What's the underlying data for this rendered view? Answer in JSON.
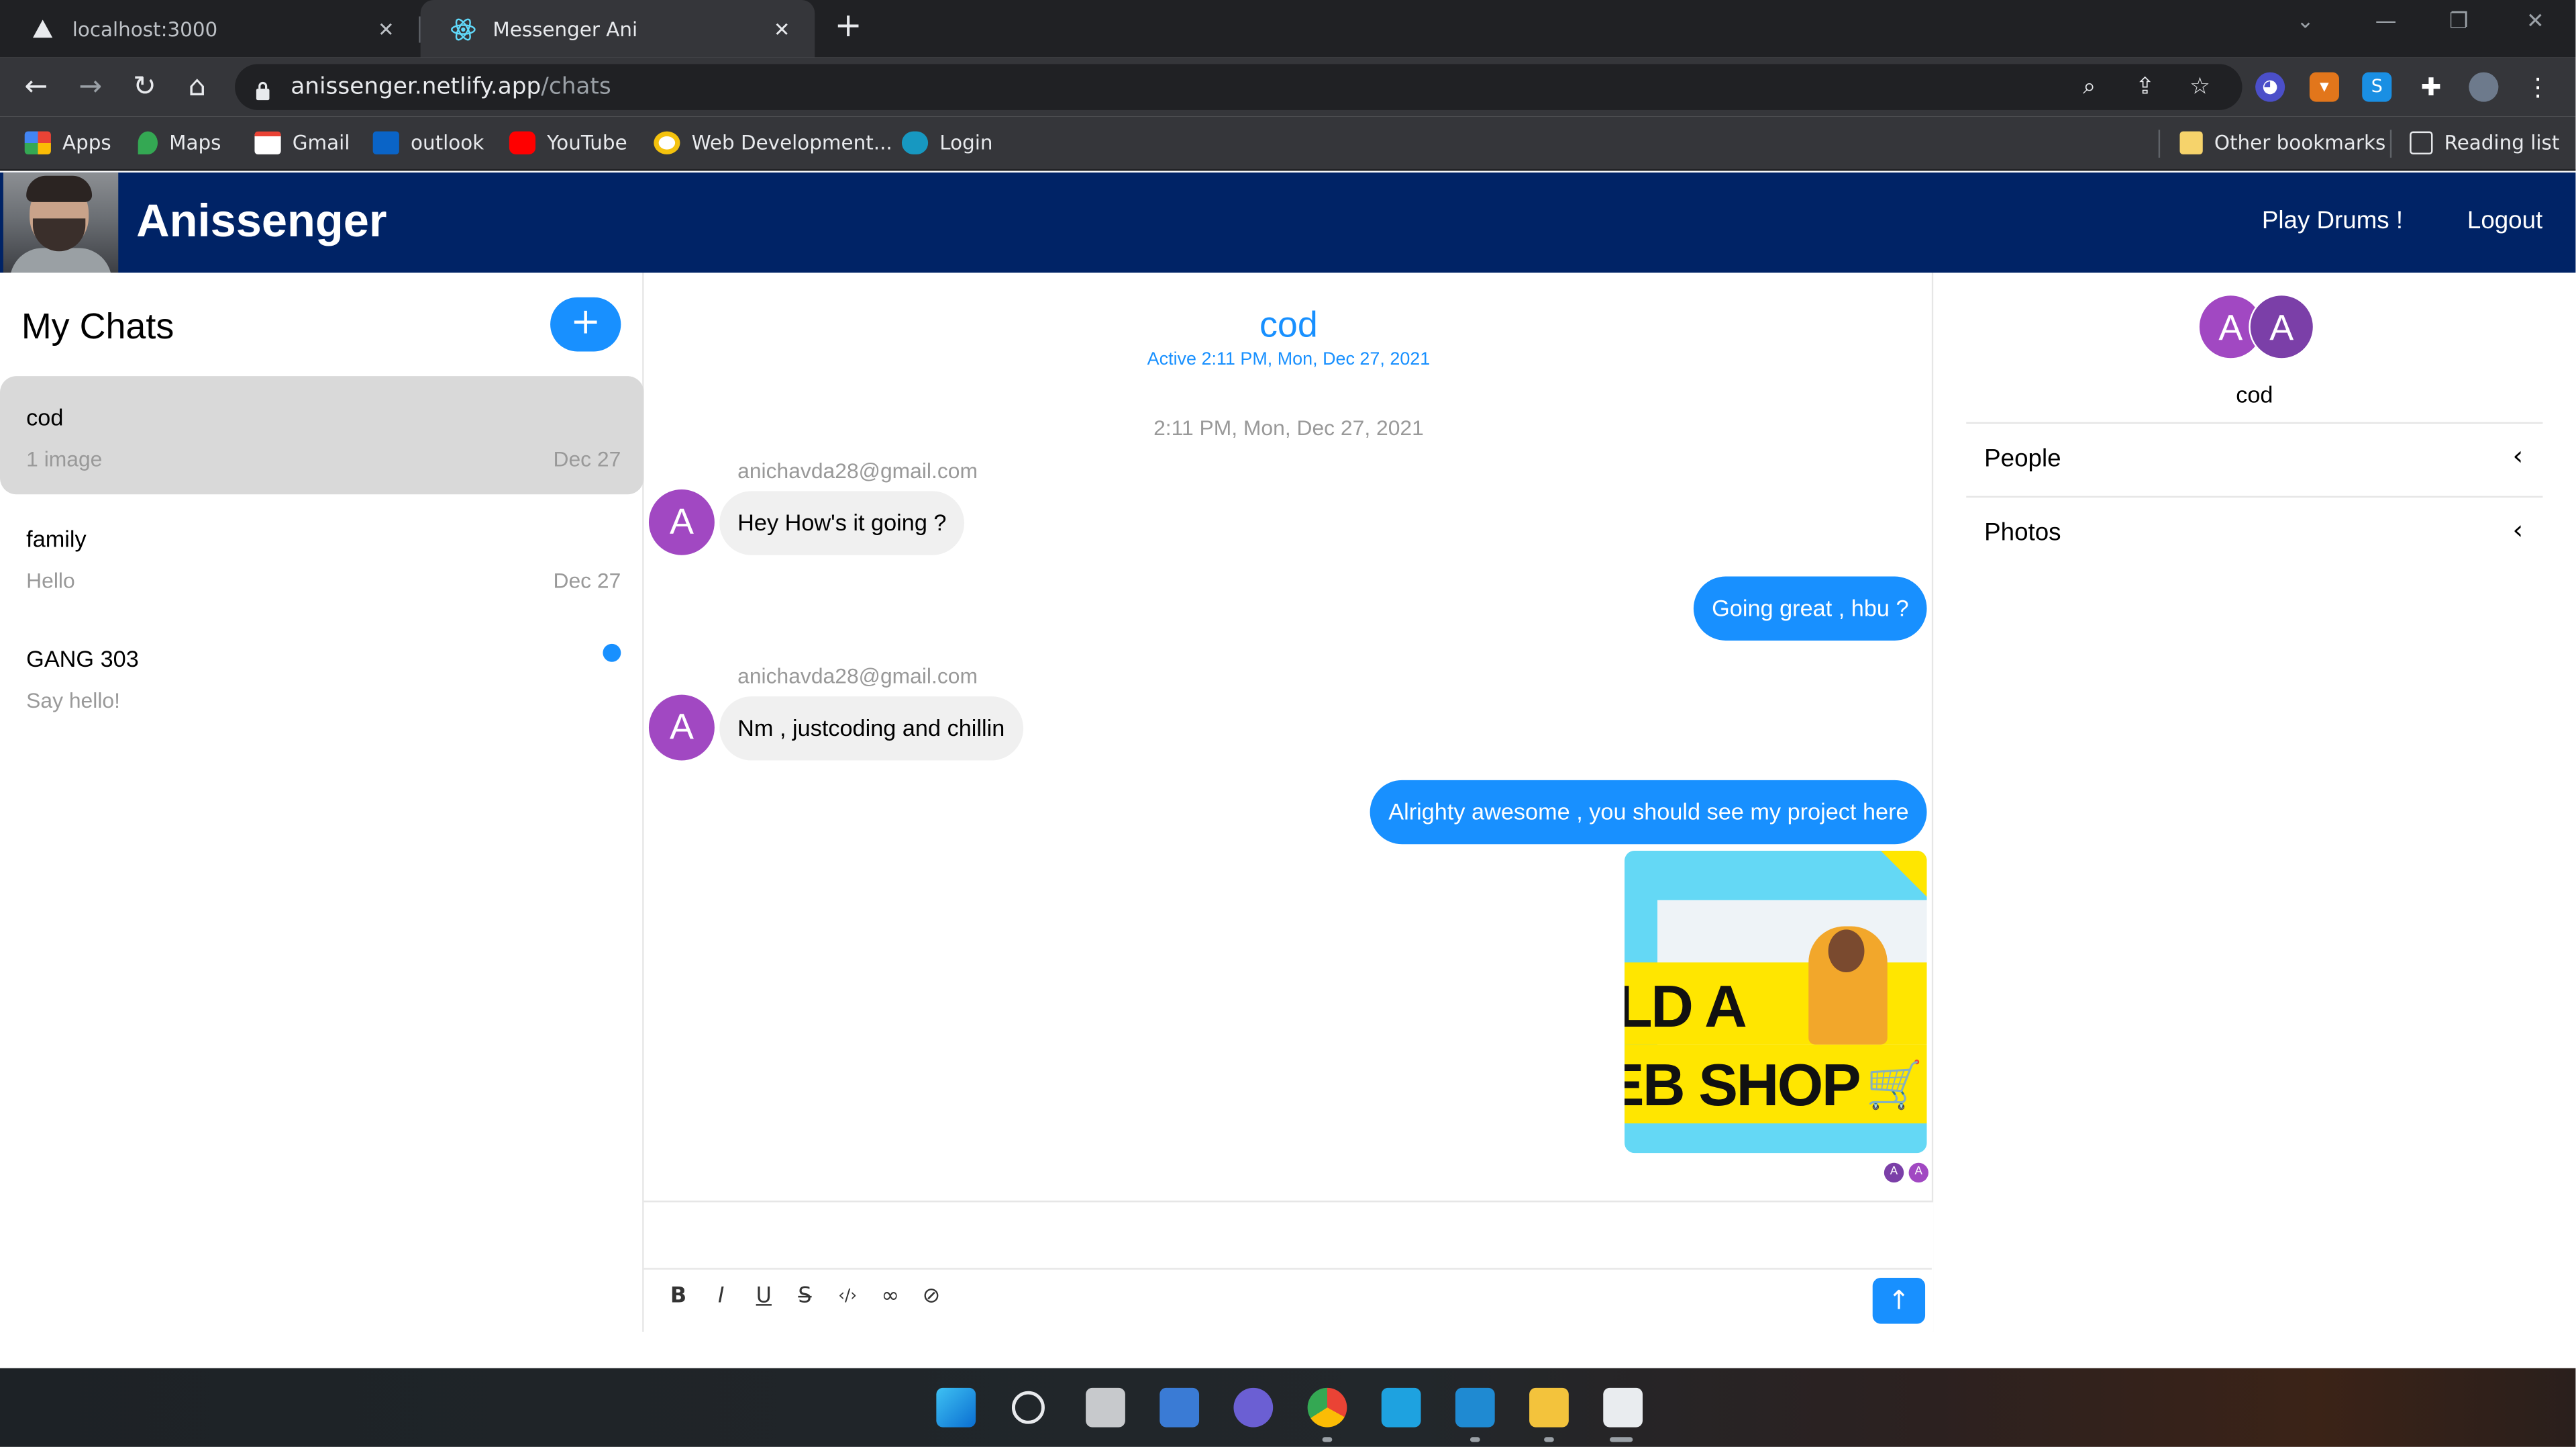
{
  "browser": {
    "tabs": [
      {
        "title": "localhost:3000",
        "active": false
      },
      {
        "title": "Messenger Ani",
        "active": true
      }
    ],
    "url_host": "anissenger.netlify.app",
    "url_path": "/chats",
    "bookmarks": [
      {
        "label": "Apps",
        "icon": "apps-grid-icon"
      },
      {
        "label": "Maps",
        "icon": "maps-icon"
      },
      {
        "label": "Gmail",
        "icon": "gmail-icon"
      },
      {
        "label": "outlook",
        "icon": "outlook-icon"
      },
      {
        "label": "YouTube",
        "icon": "youtube-icon"
      },
      {
        "label": "Web Development...",
        "icon": "bookmark-favicon-icon"
      },
      {
        "label": "Login",
        "icon": "cloud-icon"
      }
    ],
    "other_bookmarks": "Other bookmarks",
    "reading_list": "Reading list"
  },
  "app": {
    "brand": "Anissenger",
    "header_links": [
      "Play Drums !",
      "Logout"
    ],
    "header_color": "#002366",
    "accent": "#1890ff"
  },
  "chat_list": {
    "title": "My Chats",
    "new_chat_symbol": "+",
    "chats": [
      {
        "title": "cod",
        "subtitle": "1 image",
        "date": "Dec 27",
        "selected": true,
        "unread": false
      },
      {
        "title": "family",
        "subtitle": "Hello",
        "date": "Dec 27",
        "selected": false,
        "unread": false
      },
      {
        "title": "GANG 303",
        "subtitle": "Say hello!",
        "date": "",
        "selected": false,
        "unread": true
      }
    ]
  },
  "feed": {
    "title": "cod",
    "subtitle": "Active 2:11 PM, Mon, Dec 27, 2021",
    "timestamp": "2:11 PM, Mon, Dec 27, 2021",
    "messages": [
      {
        "sender": "anichavda28@gmail.com",
        "avatar": "A",
        "text": "Hey How's it going ?",
        "mine": false
      },
      {
        "sender": "",
        "avatar": "",
        "text": "Going great , hbu ?",
        "mine": true
      },
      {
        "sender": "anichavda28@gmail.com",
        "avatar": "A",
        "text": "Nm , justcoding and chillin",
        "mine": false
      },
      {
        "sender": "",
        "avatar": "",
        "text": "Alrighty awesome , you should see my project here",
        "mine": true
      }
    ],
    "attachment": {
      "line1": "ILD A",
      "line2": "EB SHOP"
    },
    "read_receipts": [
      "A",
      "A"
    ],
    "toolbar_tools": [
      "bold-icon",
      "italic-icon",
      "underline-icon",
      "strikethrough-icon",
      "code-icon",
      "link-icon",
      "attachment-icon"
    ]
  },
  "settings": {
    "avatars": [
      "A",
      "A"
    ],
    "title": "cod",
    "rows": [
      "People",
      "Photos"
    ]
  }
}
